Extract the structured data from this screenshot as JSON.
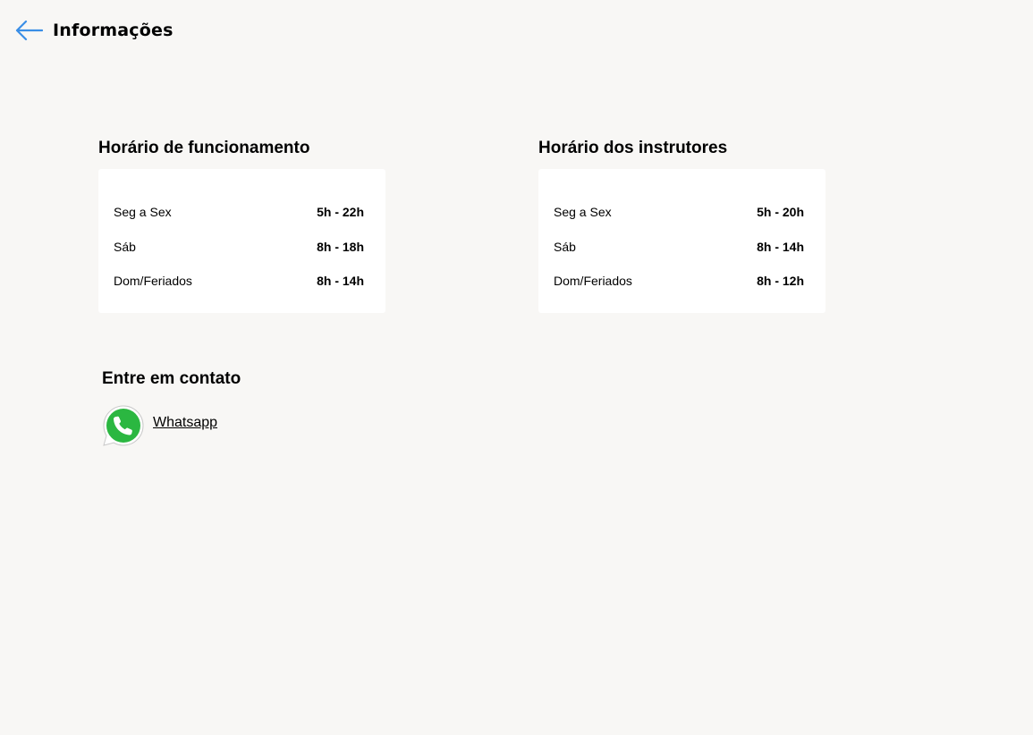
{
  "header": {
    "title": "Informações",
    "back_icon": "arrow-left-icon",
    "accent_color": "#3a8ee6"
  },
  "schedules": [
    {
      "title": "Horário de funcionamento",
      "rows": [
        {
          "day": "Seg a Sex",
          "hours": "5h - 22h"
        },
        {
          "day": "Sáb",
          "hours": "8h - 18h"
        },
        {
          "day": "Dom/Feriados",
          "hours": "8h - 14h"
        }
      ]
    },
    {
      "title": "Horário dos instrutores",
      "rows": [
        {
          "day": "Seg a Sex",
          "hours": "5h - 20h"
        },
        {
          "day": "Sáb",
          "hours": "8h - 14h"
        },
        {
          "day": "Dom/Feriados",
          "hours": "8h - 12h"
        }
      ]
    }
  ],
  "contact": {
    "title": "Entre em contato",
    "whatsapp_label": "Whatsapp",
    "whatsapp_icon": "whatsapp-icon",
    "whatsapp_color": "#2bb741"
  }
}
